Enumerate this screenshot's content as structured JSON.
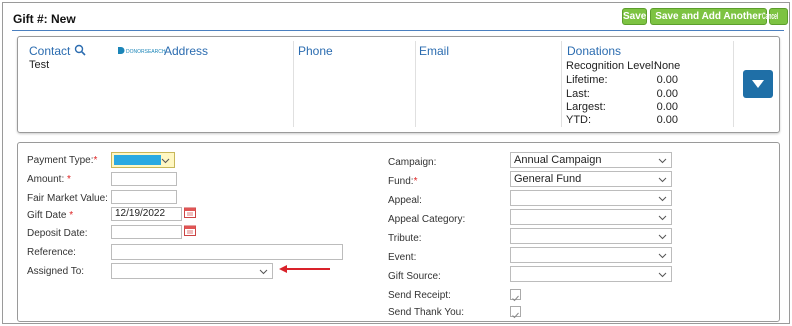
{
  "header": {
    "title": "Gift #: New",
    "save_label": "Save",
    "save_add_label": "Save and Add Another",
    "cancel_label": "Cancel"
  },
  "contact_card": {
    "contact_label": "Contact",
    "contact_name": "Test",
    "donorsearch_logo_text": "DONORSEARCH",
    "address_label": "Address",
    "phone_label": "Phone",
    "email_label": "Email",
    "donations_label": "Donations",
    "donations": [
      {
        "label": "Recognition Level:",
        "value": "None"
      },
      {
        "label": "Lifetime:",
        "value": "0.00"
      },
      {
        "label": "Last:",
        "value": "0.00"
      },
      {
        "label": "Largest:",
        "value": "0.00"
      },
      {
        "label": "YTD:",
        "value": "0.00"
      }
    ]
  },
  "form": {
    "left": {
      "payment_type_label": "Payment Type:",
      "amount_label": "Amount:",
      "fair_market_label": "Fair Market Value:",
      "gift_date_label": "Gift Date",
      "gift_date_value": "12/19/2022",
      "deposit_date_label": "Deposit Date:",
      "reference_label": "Reference:",
      "assigned_to_label": "Assigned To:"
    },
    "right": {
      "campaign_label": "Campaign:",
      "campaign_value": "Annual Campaign",
      "fund_label": "Fund:",
      "fund_value": "General Fund",
      "appeal_label": "Appeal:",
      "appeal_category_label": "Appeal Category:",
      "tribute_label": "Tribute:",
      "event_label": "Event:",
      "gift_source_label": "Gift Source:",
      "send_receipt_label": "Send Receipt:",
      "send_thank_you_label": "Send Thank You:"
    },
    "required_mark": "*"
  },
  "colors": {
    "accent": "#2b6cb0",
    "button_green": "#7dc342",
    "expand_blue": "#1f6fa7",
    "arrow_red": "#d9222a",
    "payment_type_fill": "#29a9e1"
  }
}
